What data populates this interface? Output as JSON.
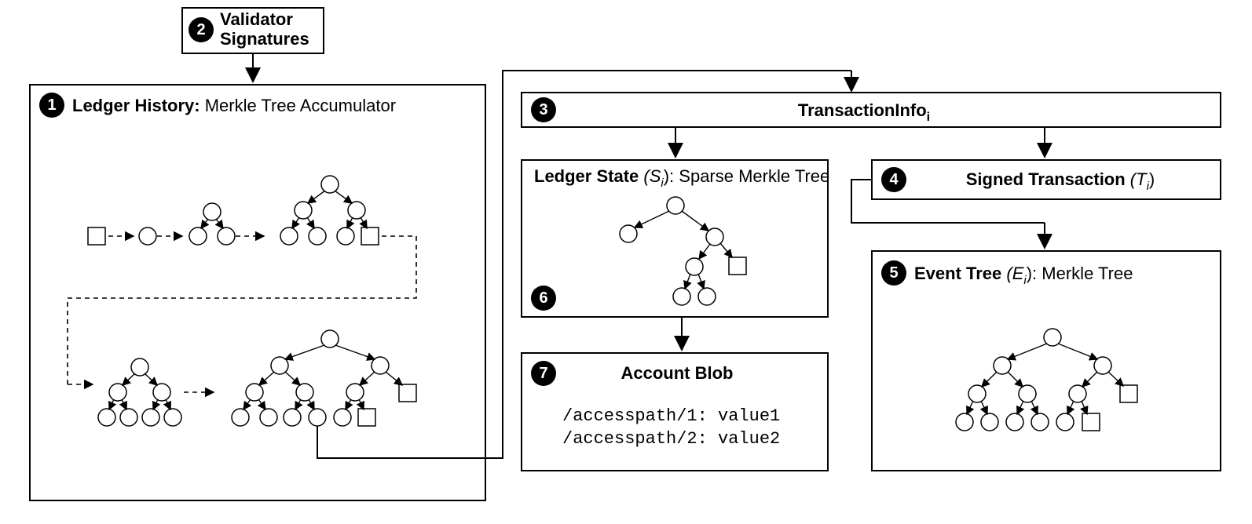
{
  "b1": {
    "num": "1",
    "title": "Ledger History:",
    "sub": " Merkle Tree Accumulator"
  },
  "b2": {
    "num": "2",
    "line1": "Validator",
    "line2": "Signatures"
  },
  "b3": {
    "num": "3",
    "title": "TransactionInfo",
    "sub": "i"
  },
  "b4": {
    "num": "4",
    "title": "Signed Transaction ",
    "var": "(T",
    "sub": "i",
    "close": ")"
  },
  "b5": {
    "num": "5",
    "title": "Event Tree ",
    "var": "(E",
    "sub": "i",
    "close": "): ",
    "sub2": "Merkle Tree"
  },
  "b6": {
    "num": "6",
    "title": "Ledger State ",
    "var": "(S",
    "sub": "i",
    "close": "): ",
    "sub2": "Sparse Merkle Tree"
  },
  "b7": {
    "num": "7",
    "title": "Account Blob",
    "l1": "/accesspath/1: value1",
    "l2": "/accesspath/2: value2"
  }
}
